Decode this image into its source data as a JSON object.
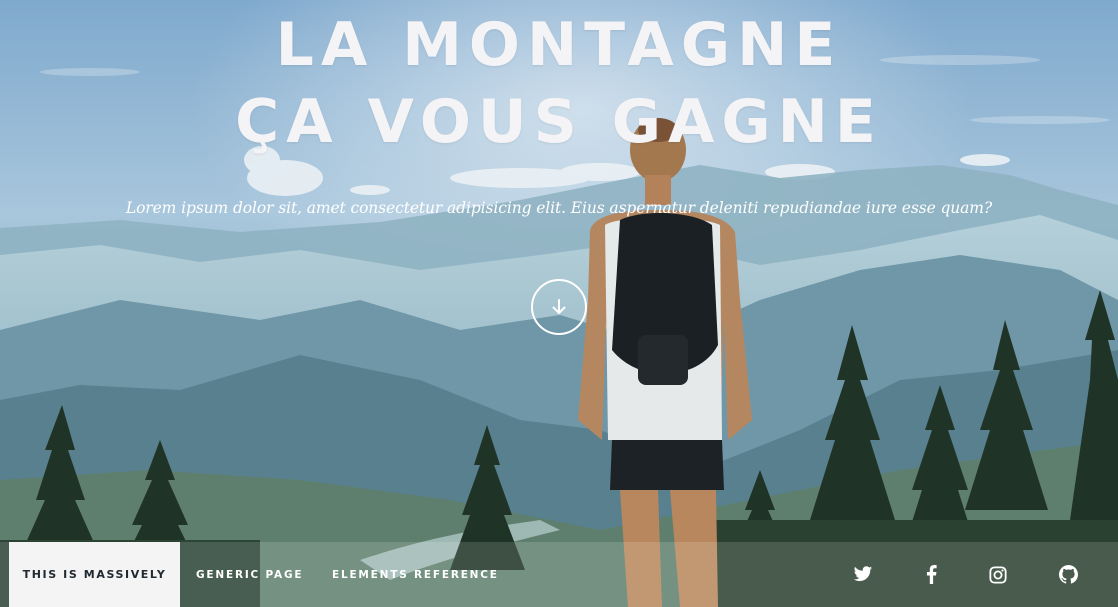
{
  "hero": {
    "title_line_1": "LA MONTAGNE",
    "title_line_2": "ÇA VOUS GAGNE",
    "subtitle": "Lorem ipsum dolor sit, amet consectetur adipisicing elit. Eius aspernatur deleniti repudiandae iure esse quam?",
    "scroll_icon": "arrow-down-icon"
  },
  "nav": {
    "brand": "THIS IS MASSIVELY",
    "links": [
      {
        "label": "GENERIC PAGE"
      },
      {
        "label": "ELEMENTS REFERENCE"
      }
    ],
    "social": [
      "twitter-icon",
      "facebook-icon",
      "instagram-icon",
      "github-icon"
    ]
  },
  "colors": {
    "text": "#f4f4f6",
    "brand_bg": "#f4f4f4",
    "brand_text": "#212931"
  }
}
